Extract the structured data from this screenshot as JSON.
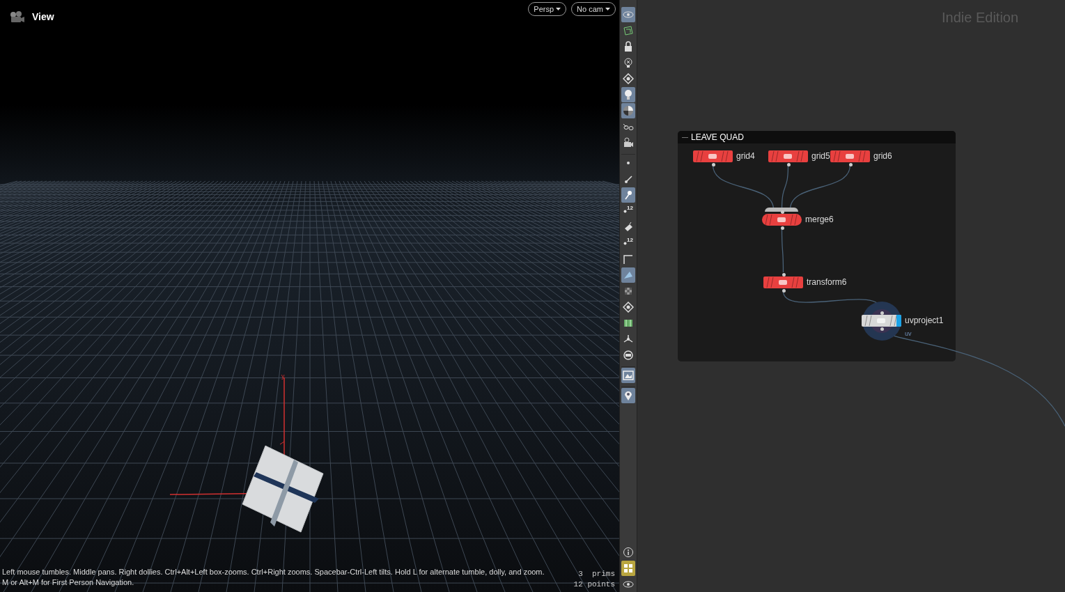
{
  "viewport": {
    "title": "View",
    "menus": [
      {
        "label": "Persp"
      },
      {
        "label": "No cam"
      }
    ],
    "hint": "Left mouse tumbles. Middle pans. Right dollies. Ctrl+Alt+Left box-zooms. Ctrl+Right zooms. Spacebar-Ctrl-Left tilts. Hold L for alternate tumble, dolly, and zoom. M or Alt+M for First Person Navigation.",
    "stats": [
      "3  prims",
      "12 points"
    ],
    "axis_label": "y"
  },
  "toolbar": {
    "tools": [
      {
        "kind": "eye",
        "selected": true
      },
      {
        "kind": "wire",
        "selected": false
      },
      {
        "kind": "lock",
        "selected": false
      },
      {
        "kind": "bulbx",
        "selected": false
      },
      {
        "kind": "diamond",
        "selected": false
      },
      {
        "kind": "bulb",
        "selected": true
      },
      {
        "kind": "shade",
        "selected": true
      },
      {
        "kind": "glasses",
        "selected": false
      },
      {
        "kind": "camera",
        "selected": false
      },
      {
        "kind": "dot",
        "selected": false
      },
      {
        "kind": "normal",
        "selected": false
      },
      {
        "kind": "pin",
        "selected": true
      },
      {
        "kind": "number",
        "label": "12",
        "selected": false
      },
      {
        "kind": "brush",
        "selected": false
      },
      {
        "kind": "number",
        "label": "12",
        "selected": false
      },
      {
        "kind": "corner",
        "selected": false
      },
      {
        "kind": "wing",
        "selected": true
      },
      {
        "kind": "checker",
        "selected": false
      },
      {
        "kind": "diamond",
        "selected": false
      },
      {
        "kind": "uvmap",
        "selected": false
      },
      {
        "kind": "joint",
        "selected": false
      },
      {
        "kind": "disc",
        "selected": false
      },
      {
        "kind": "picture",
        "selected": true
      },
      {
        "kind": "marker",
        "selected": true
      }
    ],
    "bottom_tools": [
      {
        "kind": "info",
        "selected": false
      },
      {
        "kind": "grid",
        "selected": true
      },
      {
        "kind": "eye",
        "selected": false
      }
    ]
  },
  "network": {
    "watermark": "Indie Edition",
    "box": {
      "title": "LEAVE QUAD",
      "collapse": "—"
    },
    "nodes": [
      {
        "label": "grid4",
        "color": "#e8403f"
      },
      {
        "label": "grid5",
        "color": "#e8403f"
      },
      {
        "label": "grid6",
        "color": "#e8403f"
      },
      {
        "label": "merge6",
        "color": "#e8403f",
        "kind": "merge"
      },
      {
        "label": "transform6",
        "color": "#e8403f"
      },
      {
        "label": "uvproject1",
        "color": "#d8d8d8",
        "display": true,
        "current": true,
        "subtitle": "uv"
      }
    ]
  }
}
